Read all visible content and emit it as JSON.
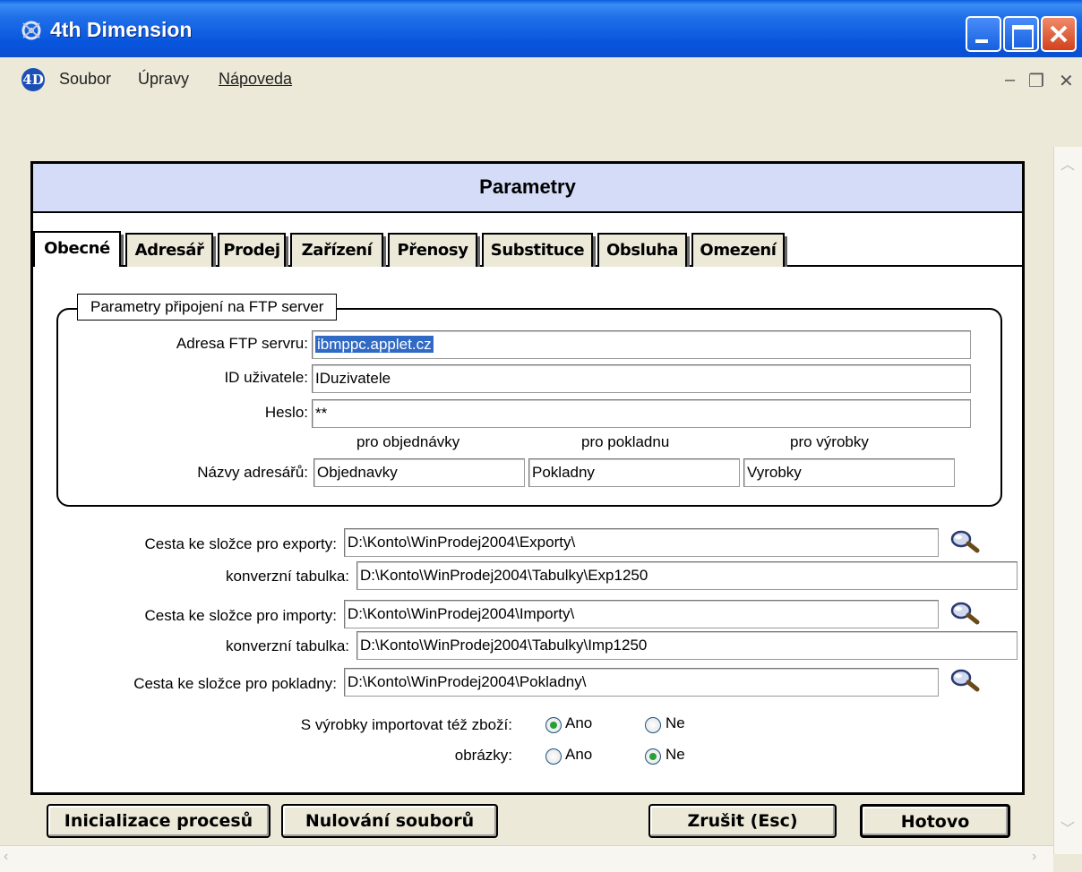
{
  "window": {
    "title": "4th Dimension"
  },
  "menu": {
    "items": [
      "Soubor",
      "Úpravy",
      "Nápoveda"
    ]
  },
  "form": {
    "title": "Parametry",
    "tabs": [
      "Obecné",
      "Adresář",
      "Prodej",
      "Zařízení",
      "Přenosy",
      "Substituce",
      "Obsluha",
      "Omezení"
    ],
    "active_tab": "Obecné",
    "ftp_group": {
      "legend": "Parametry připojení na FTP server",
      "address_label": "Adresa FTP servru:",
      "address_value": "ibmppc.applet.cz",
      "user_label": "ID uživatele:",
      "user_value": "IDuzivatele",
      "password_label": "Heslo:",
      "password_value": "**",
      "dirs_label": "Názvy adresářů:",
      "col_orders": "pro objednávky",
      "col_register": "pro pokladnu",
      "col_products": "pro výrobky",
      "dir_orders": "Objednavky",
      "dir_register": "Pokladny",
      "dir_products": "Vyrobky"
    },
    "paths": {
      "export_label": "Cesta ke složce pro exporty:",
      "export_value": "D:\\Konto\\WinProdej2004\\Exporty\\",
      "export_table_label": "konverzní tabulka:",
      "export_table_value": "D:\\Konto\\WinProdej2004\\Tabulky\\Exp1250",
      "import_label": "Cesta ke složce pro importy:",
      "import_value": "D:\\Konto\\WinProdej2004\\Importy\\",
      "import_table_label": "konverzní tabulka:",
      "import_table_value": "D:\\Konto\\WinProdej2004\\Tabulky\\Imp1250",
      "register_label": "Cesta ke složce pro pokladny:",
      "register_value": "D:\\Konto\\WinProdej2004\\Pokladny\\"
    },
    "options": {
      "goods_label": "S výrobky importovat též zboží:",
      "images_label": "obrázky:",
      "yes": "Ano",
      "no": "Ne",
      "goods_selected": "Ano",
      "images_selected": "Ne"
    },
    "buttons": {
      "init": "Inicializace procesů",
      "reset": "Nulování souborů",
      "cancel": "Zrušit (Esc)",
      "done": "Hotovo"
    }
  },
  "colors": {
    "titlebar": "#0a55dd",
    "header_band": "#d4dcf8",
    "selection": "#316ac5",
    "radio_dot": "#27a035"
  }
}
